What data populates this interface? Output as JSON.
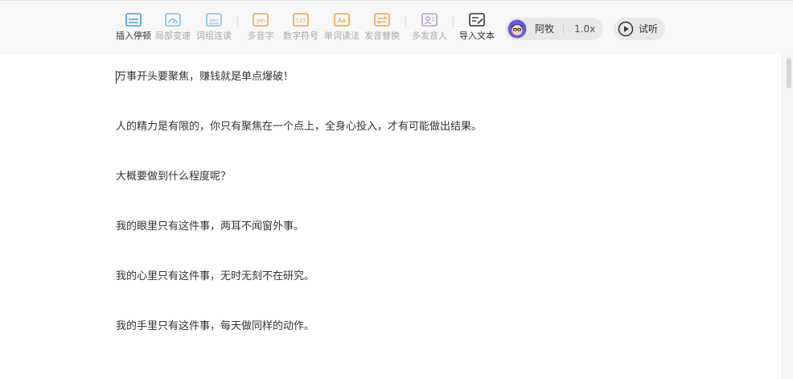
{
  "toolbar": {
    "tools": [
      {
        "label": "插入停顿",
        "icon": "pause-insert-icon",
        "active": true
      },
      {
        "label": "局部变速",
        "icon": "speed-gauge-icon",
        "active": false
      },
      {
        "label": "词组连读",
        "icon": "phrase-abc-icon",
        "active": false
      },
      {
        "label": "多音字",
        "icon": "pinyin-yin-icon",
        "active": false
      },
      {
        "label": "数字符号",
        "icon": "number-123-icon",
        "active": false
      },
      {
        "label": "单词读法",
        "icon": "word-aa-icon",
        "active": false
      },
      {
        "label": "发音替换",
        "icon": "pronounce-replace-icon",
        "active": false
      },
      {
        "label": "多发音人",
        "icon": "multi-speaker-icon",
        "active": false
      },
      {
        "label": "导入文本",
        "icon": "import-text-icon",
        "active": true
      }
    ],
    "voice": {
      "name": "阿牧",
      "speed": "1.0x",
      "avatar_icon": "voice-avatar-icon"
    },
    "listen_label": "试听",
    "listen_icon": "play-circle-icon"
  },
  "editor": {
    "paragraphs": [
      "万事开头要聚焦，赚钱就是单点爆破！",
      "人的精力是有限的，你只有聚焦在一个点上，全身心投入，才有可能做出结果。",
      "大概要做到什么程度呢？",
      "我的眼里只有这件事，两耳不闻窗外事。",
      "我的心里只有这件事，无时无刻不在研究。",
      "我的手里只有这件事，每天做同样的动作。"
    ]
  },
  "colors": {
    "blue": "#3a9be0",
    "light_blue": "#7cc0ef",
    "orange": "#f0a23a",
    "purple": "#b79ad8",
    "dark": "#333333",
    "muted": "#a8a8a8"
  }
}
